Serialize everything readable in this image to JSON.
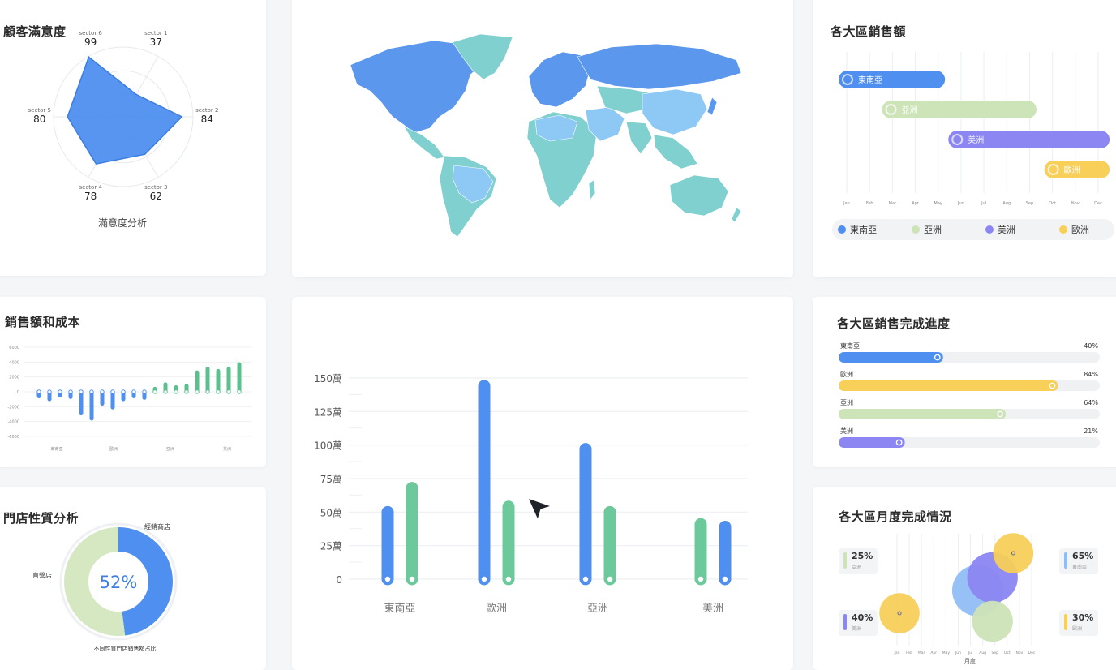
{
  "radar": {
    "title": "顧客滿意度",
    "subtitle": "滿意度分析",
    "chart_data": {
      "type": "radar",
      "categories": [
        "sector 1",
        "sector 2",
        "sector 3",
        "sector 4",
        "sector 5",
        "sector 6"
      ],
      "values": [
        37,
        84,
        62,
        78,
        80,
        99
      ],
      "max": 100,
      "color": "#4e8ff0"
    }
  },
  "map": {
    "colors": {
      "primary": "#5b97ec",
      "secondary": "#7fd0cf",
      "light": "#8ec8f5"
    }
  },
  "timeline": {
    "title": "各大區銷售額",
    "chart_data": {
      "type": "timeline",
      "months": [
        "Jan",
        "Feb",
        "Mar",
        "Apr",
        "May",
        "Jun",
        "Jul",
        "Aug",
        "Sep",
        "Oct",
        "Nov",
        "Dec"
      ],
      "series": [
        {
          "name": "東南亞",
          "start": 0,
          "end": 4.3,
          "color": "#4e8ff0"
        },
        {
          "name": "亞洲",
          "start": 1.9,
          "end": 8.3,
          "color": "#cde3b8"
        },
        {
          "name": "美洲",
          "start": 4.8,
          "end": 11.5,
          "color": "#8b86f2"
        },
        {
          "name": "歐洲",
          "start": 9.0,
          "end": 11.5,
          "color": "#f7cf59"
        }
      ]
    }
  },
  "sales_cost": {
    "title": "銷售額和成本",
    "chart_data": {
      "type": "bar",
      "yticks": [
        "6000",
        "4000",
        "2000",
        "0",
        "-2000",
        "-4000",
        "-6000"
      ],
      "ylim": [
        -6000,
        6000
      ],
      "xlabels": [
        "東南亞",
        "歐洲",
        "亞洲",
        "美洲"
      ],
      "values": [
        -600,
        -1000,
        -500,
        -700,
        -2900,
        -3600,
        -1600,
        -2100,
        -1000,
        -600,
        -800,
        400,
        1000,
        600,
        800,
        2600,
        3100,
        2800,
        3100,
        3700
      ],
      "colors": {
        "negative": "#4e8ff0",
        "positive": "#59c08e"
      }
    }
  },
  "main_bar": {
    "chart_data": {
      "type": "bar",
      "categories": [
        "東南亞",
        "歐洲",
        "亞洲",
        "美洲"
      ],
      "yticks": [
        "0",
        "25萬",
        "50萬",
        "75萬",
        "100萬",
        "125萬",
        "150萬"
      ],
      "ylim": [
        0,
        150
      ],
      "series": [
        {
          "name": "",
          "color": "#4e8ff0",
          "values": [
            50,
            144,
            97,
            39
          ]
        },
        {
          "name": "",
          "color": "#6cc99b",
          "values": [
            68,
            54,
            50,
            41
          ]
        }
      ]
    }
  },
  "donut": {
    "title": "門店性質分析",
    "center_label": "52%",
    "subtitle": "不同性質門店銷售額占比",
    "chart_data": {
      "type": "pie",
      "slices": [
        {
          "label": "經銷商店",
          "value": 48,
          "color": "#4e8ff0"
        },
        {
          "label": "直營店",
          "value": 52,
          "color": "#d5e8c2"
        }
      ]
    }
  },
  "progress": {
    "title": "各大區銷售完成進度",
    "items": [
      {
        "name": "東南亞",
        "pct_label": "40%",
        "value": 0.4,
        "color": "#4e8ff0"
      },
      {
        "name": "歐洲",
        "pct_label": "84%",
        "value": 0.84,
        "color": "#f7cf59"
      },
      {
        "name": "亞洲",
        "pct_label": "64%",
        "value": 0.64,
        "color": "#cde3b8"
      },
      {
        "name": "美洲",
        "pct_label": "21%",
        "value": 0.21,
        "color": "#8b86f2"
      }
    ]
  },
  "bubble": {
    "title": "各大區月度完成情況",
    "xlabel": "月度",
    "months": [
      "Jan",
      "Feb",
      "Mar",
      "Apr",
      "May",
      "Jun",
      "Jul",
      "Aug",
      "Sep",
      "Oct",
      "Nov",
      "Dec"
    ],
    "stats": [
      {
        "pct": "25%",
        "name": "亞洲",
        "color": "#cde3b8"
      },
      {
        "pct": "40%",
        "name": "美洲",
        "color": "#8b86f2"
      },
      {
        "pct": "65%",
        "name": "東南亞",
        "color": "#8fbdf5"
      },
      {
        "pct": "30%",
        "name": "歐洲",
        "color": "#f7cf59"
      }
    ],
    "chart_data": {
      "type": "bubble",
      "points": [
        {
          "name": "東南亞",
          "month": 7.6,
          "size": 65,
          "color": "#90bdf5"
        },
        {
          "name": "美洲",
          "month": 8.8,
          "size": 40,
          "color": "#8b86f2"
        },
        {
          "name": "亞洲",
          "month": 8.8,
          "size": 25,
          "color": "#cde3b8"
        },
        {
          "name": "歐洲",
          "month": 10.5,
          "size": 10,
          "color": "#f7cf59"
        },
        {
          "name": "歐洲",
          "month": 1.2,
          "size": 10,
          "color": "#f7cf59"
        }
      ]
    }
  }
}
